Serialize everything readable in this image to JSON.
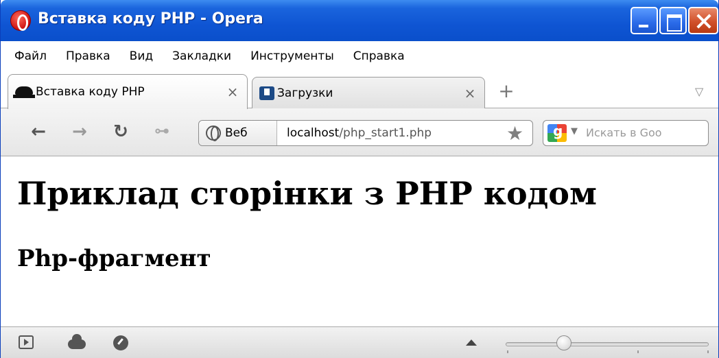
{
  "window": {
    "title": "Вставка коду PHP - Opera"
  },
  "menu": {
    "items": [
      "Файл",
      "Правка",
      "Вид",
      "Закладки",
      "Инструменты",
      "Справка"
    ]
  },
  "tabs": [
    {
      "label": "Вставка коду PHP",
      "icon": "spy-icon",
      "active": true,
      "close": "×"
    },
    {
      "label": "Загрузки",
      "icon": "download-icon",
      "active": false,
      "close": "×"
    }
  ],
  "tabbar": {
    "new_tab": "+",
    "tab_menu": "▽"
  },
  "nav": {
    "back": "←",
    "forward": "→",
    "reload": "↻",
    "key": "⊶"
  },
  "address": {
    "badge_label": "Веб",
    "host": "localhost",
    "path": "/php_start1.php",
    "bookmark": "★"
  },
  "search": {
    "placeholder": "Искать в Goo",
    "dropdown": "▼"
  },
  "content": {
    "heading": "Приклад сторінки з PHP кодом",
    "subheading": "Php-фрагмент"
  }
}
